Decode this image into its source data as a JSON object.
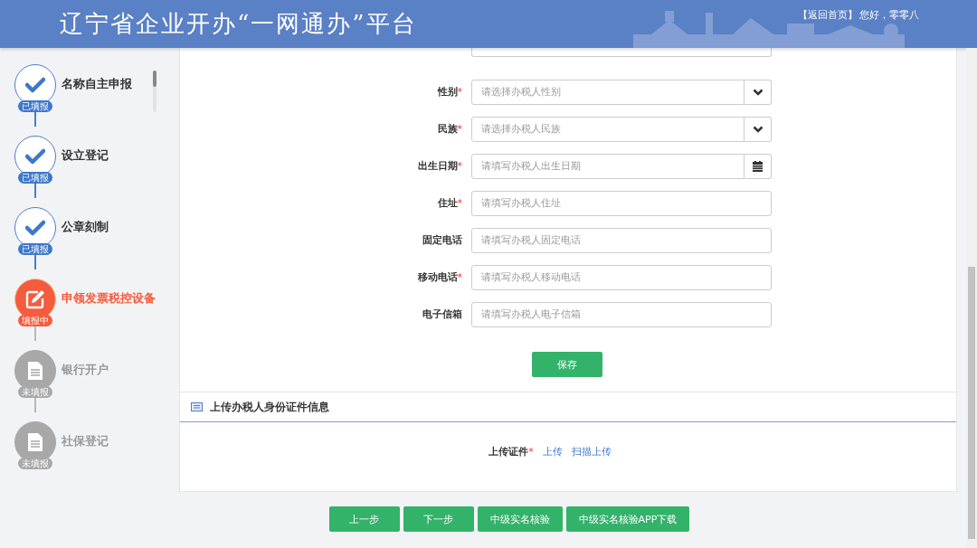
{
  "header": {
    "title": "辽宁省企业开办“一网通办”平台",
    "home_link": "【返回首页】",
    "greeting": "您好，零零八"
  },
  "steps": [
    {
      "label": "名称自主申报",
      "status": "已填报",
      "kind": "done"
    },
    {
      "label": "设立登记",
      "status": "已填报",
      "kind": "done"
    },
    {
      "label": "公章刻制",
      "status": "已填报",
      "kind": "done"
    },
    {
      "label": "申领发票税控设备",
      "status": "填报中",
      "kind": "current"
    },
    {
      "label": "银行开户",
      "status": "未填报",
      "kind": "pending"
    },
    {
      "label": "社保登记",
      "status": "未填报",
      "kind": "pending"
    }
  ],
  "form": {
    "fields": [
      {
        "label": "性别",
        "required_mark": "*",
        "kind": "select",
        "placeholder": "请选择办税人性别"
      },
      {
        "label": "民族",
        "required_mark": "*",
        "kind": "select",
        "placeholder": "请选择办税人民族"
      },
      {
        "label": "出生日期",
        "required_mark": "*",
        "kind": "date",
        "placeholder": "请填写办税人出生日期"
      },
      {
        "label": "住址",
        "required_mark": "*",
        "kind": "text",
        "placeholder": "请填写办税人住址"
      },
      {
        "label": "固定电话",
        "kind": "text",
        "placeholder": "请填写办税人固定电话"
      },
      {
        "label": "移动电话",
        "required_mark": "*",
        "kind": "text",
        "placeholder": "请填写办税人移动电话"
      },
      {
        "label": "电子信箱",
        "kind": "text",
        "placeholder": "请填写办税人电子信箱"
      }
    ],
    "save": "保存"
  },
  "upload": {
    "title": "上传办税人身份证件信息",
    "label": "上传证件",
    "required_mark": "*",
    "links": [
      "上传",
      "扫描上传"
    ]
  },
  "buttons": [
    "上一步",
    "下一步",
    "中级实名核验",
    "中级实名核验APP下载"
  ]
}
